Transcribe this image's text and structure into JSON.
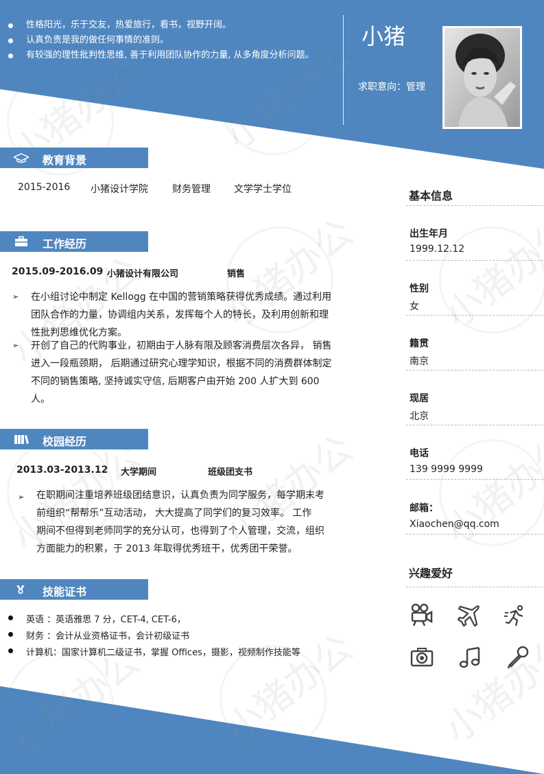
{
  "intro": [
    "性格阳光，乐于交友，热爱旅行，看书，视野开阔。",
    "认真负责是我的做任何事情的准则。",
    "有较强的理性批判性思维, 善于利用团队协作的力量, 从多角度分析问题。"
  ],
  "profile": {
    "name": "小猪",
    "intent": "求职意向：管理"
  },
  "watermark": "小猪办公",
  "colors": {
    "accent": "#4f86bf"
  },
  "education": {
    "title": "教育背景",
    "icon": "graduation-cap-icon",
    "period": "2015-2016",
    "school": "小猪设计学院",
    "major": "财务管理",
    "degree": "文学学士学位"
  },
  "work": {
    "title": "工作经历",
    "icon": "briefcase-icon",
    "period": "2015.09-2016.09",
    "company": "小猪设计有限公司",
    "position": "销售",
    "bullets": [
      [
        "在小组讨论中制定 Kellogg 在中国的营销策略获得优秀成绩。通过利用",
        "团队合作的力量，协调组内关系，发挥每个人的特长，及利用创新和理",
        "性批判思维优化方案。"
      ],
      [
        "开创了自己的代购事业，初期由于人脉有限及顾客消费层次各异，  销售",
        "进入一段瓶颈期，  后期通过研究心理学知识，根据不同的消费群体制定",
        "不同的销售策略, 坚持诚实守信, 后期客户由开始 200 人扩大到 600 人。"
      ]
    ]
  },
  "campus": {
    "title": "校园经历",
    "icon": "books-icon",
    "period": "2013.03-2013.12",
    "stage": "大学期间",
    "role": "班级团支书",
    "bullets": [
      [
        "在职期间注重培养班级团结意识，认真负责为同学服务，每学期末考",
        "前组织“帮帮乐”互动活动，  大大提高了同学们的复习效率。  工作",
        "期间不但得到老师同学的充分认可，也得到了个人管理，交流，组织",
        "方面能力的积累，于 2013 年取得优秀班干，优秀团干荣誉。"
      ]
    ]
  },
  "skills": {
    "title": "技能证书",
    "icon": "medal-icon",
    "items": [
      "英语    ：英语雅思 7 分，CET-4, CET-6，",
      "财务    ：会计从业资格证书，会计初级证书",
      "计算机：国家计算机二级证书，掌握 Offices，摄影，视频制作技能等"
    ]
  },
  "basic_info": {
    "title": "基本信息",
    "fields": [
      {
        "label": "出生年月",
        "value": "1999.12.12"
      },
      {
        "label": "性别",
        "value": "女"
      },
      {
        "label": "籍贯",
        "value": "南京"
      },
      {
        "label": "现居",
        "value": "北京"
      },
      {
        "label": "电话",
        "value": "139 9999 9999"
      },
      {
        "label": "邮箱：",
        "value": "Xiaochen@qq.com"
      }
    ]
  },
  "hobbies": {
    "title": "兴趣爱好",
    "icons": [
      "film-camera-icon",
      "airplane-icon",
      "running-icon",
      "photo-camera-icon",
      "music-note-icon",
      "microphone-icon"
    ]
  }
}
